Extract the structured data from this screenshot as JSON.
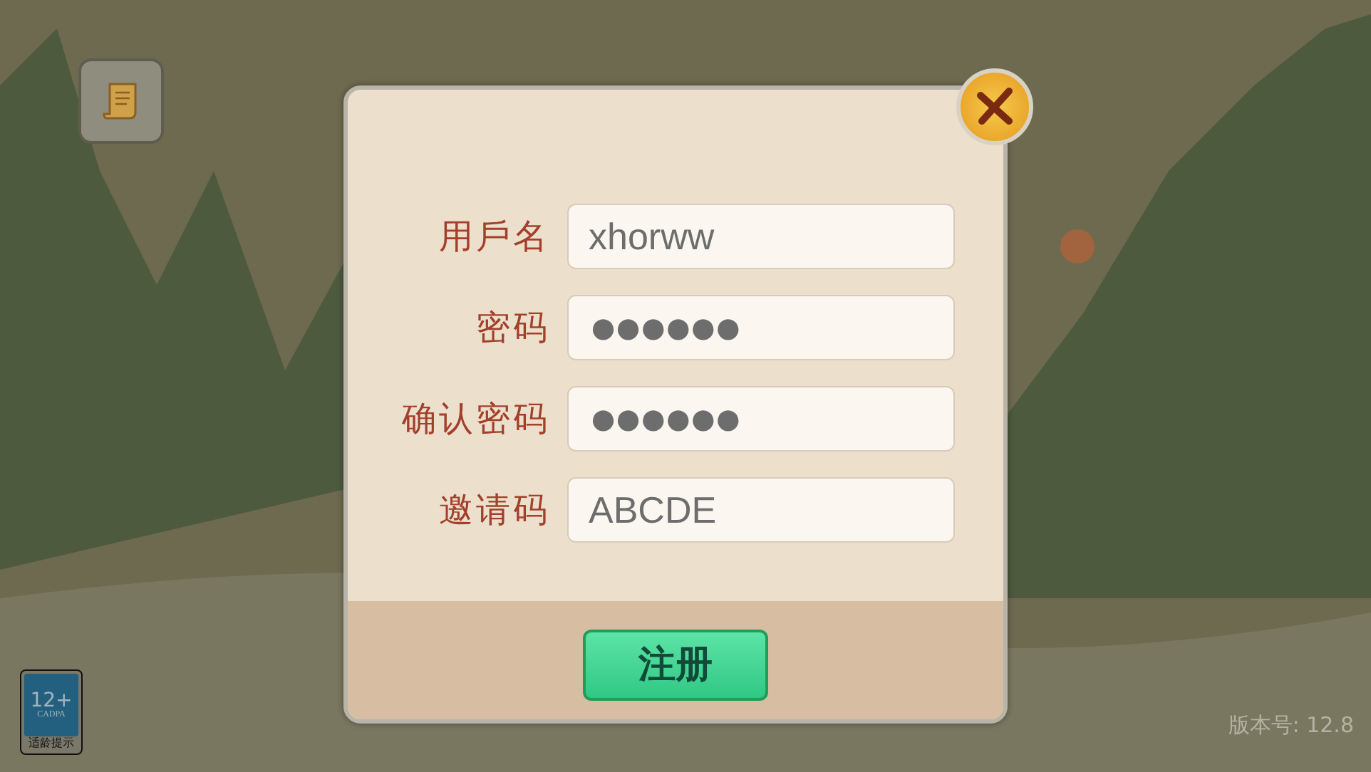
{
  "age_badge": {
    "rating": "12+",
    "org": "CADPA",
    "caption": "适龄提示"
  },
  "dialog": {
    "fields": [
      {
        "label": "用戶名",
        "value": "xhorww",
        "kind": "text"
      },
      {
        "label": "密码",
        "value": "●●●●●●",
        "kind": "password"
      },
      {
        "label": "确认密码",
        "value": "●●●●●●",
        "kind": "password"
      },
      {
        "label": "邀请码",
        "value": "ABCDE",
        "kind": "text"
      }
    ],
    "submit": "注册"
  },
  "version": "版本号: 12.8"
}
